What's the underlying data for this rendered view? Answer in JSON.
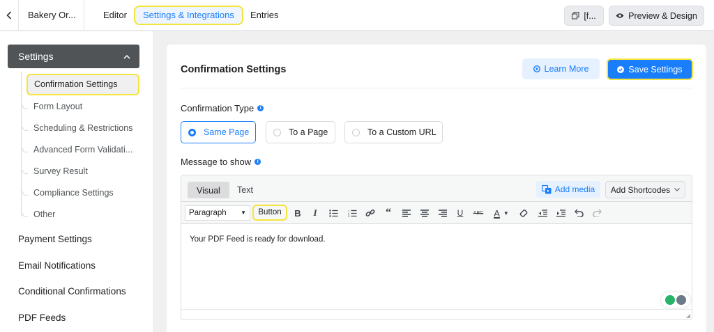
{
  "topbar": {
    "form_title": "Bakery Or...",
    "tabs": [
      "Editor",
      "Settings & Integrations",
      "Entries"
    ],
    "shortcode_label": "[f...",
    "preview_label": "Preview & Design"
  },
  "sidebar": {
    "section_title": "Settings",
    "sub_items": [
      "Confirmation Settings",
      "Form Layout",
      "Scheduling & Restrictions",
      "Advanced Form Validati...",
      "Survey Result",
      "Compliance Settings",
      "Other"
    ],
    "main_items": [
      "Payment Settings",
      "Email Notifications",
      "Conditional Confirmations",
      "PDF Feeds"
    ]
  },
  "main": {
    "title": "Confirmation Settings",
    "learn_more": "Learn More",
    "save": "Save Settings",
    "confirmation_type_label": "Confirmation Type",
    "confirmation_options": [
      "Same Page",
      "To a Page",
      "To a Custom URL"
    ],
    "selected_option": "Same Page",
    "message_label": "Message to show",
    "editor": {
      "tab_visual": "Visual",
      "tab_text": "Text",
      "add_media": "Add media",
      "add_shortcodes": "Add Shortcodes",
      "format": "Paragraph",
      "button_label": "Button",
      "content": "Your PDF Feed is ready for download."
    }
  },
  "colors": {
    "accent": "#1a7efb",
    "highlight": "#f5e43c",
    "sidebar_head": "#505457"
  }
}
